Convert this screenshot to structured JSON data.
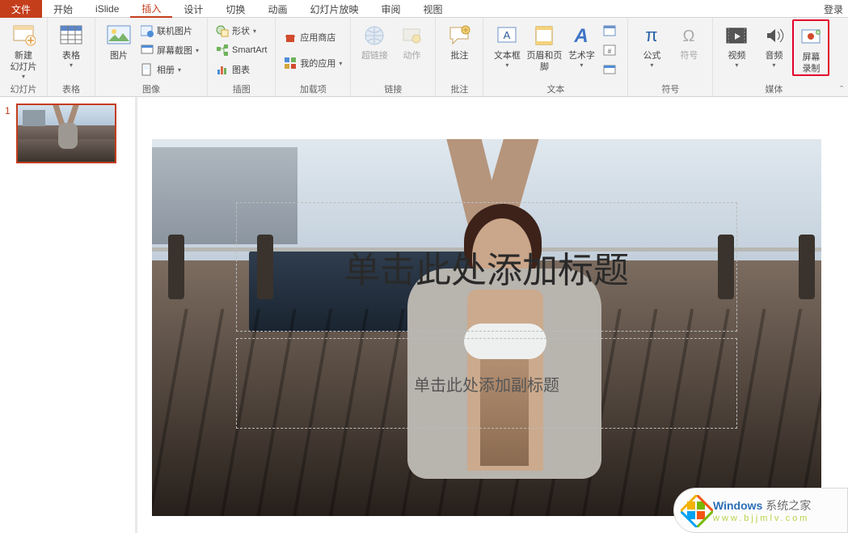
{
  "tabs": {
    "file": "文件",
    "home": "开始",
    "islide": "iSlide",
    "insert": "插入",
    "design": "设计",
    "transition": "切换",
    "animation": "动画",
    "slideshow": "幻灯片放映",
    "review": "审阅",
    "view": "视图"
  },
  "login": "登录",
  "ribbon": {
    "new_slide": "新建\n幻灯片",
    "table": "表格",
    "picture": "图片",
    "online_pic": "联机图片",
    "screenshot": "屏幕截图",
    "album": "相册",
    "shapes": "形状",
    "smartart": "SmartArt",
    "chart": "图表",
    "store": "应用商店",
    "myapps": "我的应用",
    "hyperlink": "超链接",
    "action": "动作",
    "comment": "批注",
    "textbox": "文本框",
    "headerfooter": "页眉和页脚",
    "wordart": "艺术字",
    "equation": "公式",
    "symbol": "符号",
    "video": "视频",
    "audio": "音频",
    "screenrec": "屏幕\n录制"
  },
  "groups": {
    "slides": "幻灯片",
    "tables": "表格",
    "images": "图像",
    "illustrations": "插图",
    "addins": "加载项",
    "links": "链接",
    "comments": "批注",
    "text": "文本",
    "symbols": "符号",
    "media": "媒体"
  },
  "slide": {
    "number": "1",
    "title_placeholder": "单击此处添加标题",
    "subtitle_placeholder": "单击此处添加副标题"
  },
  "watermark": {
    "brand1": "Windows",
    "brand2": " 系统之家",
    "url": "www.bjjmlv.com"
  }
}
